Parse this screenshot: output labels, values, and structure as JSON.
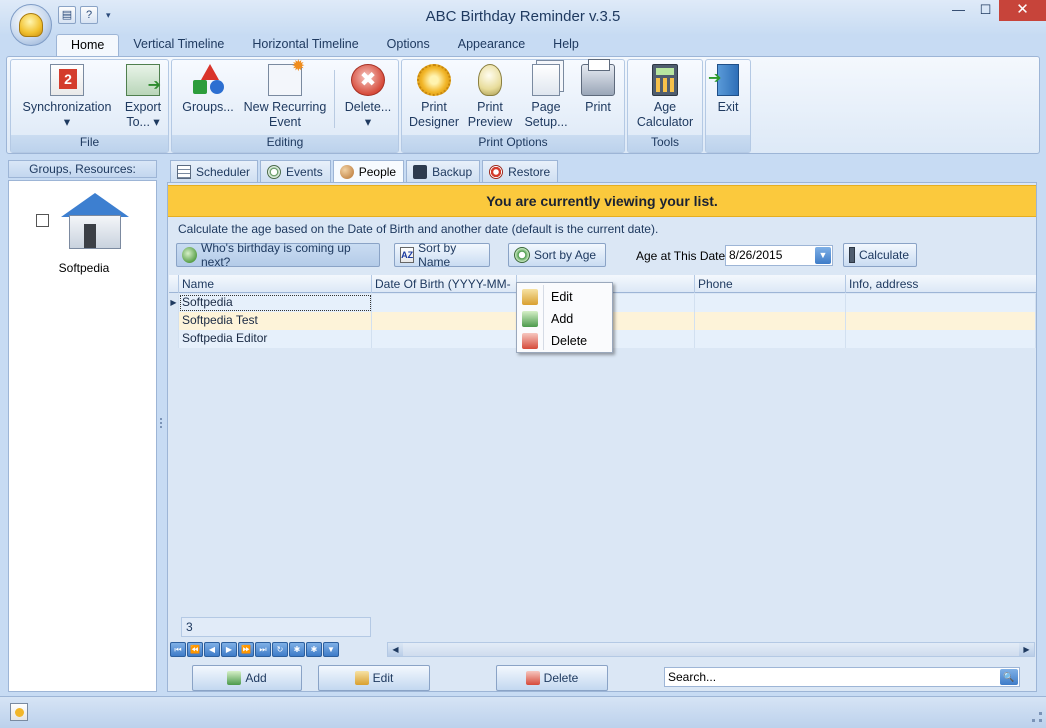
{
  "window": {
    "title": "ABC Birthday Reminder v.3.5",
    "minimize": "—",
    "maximize": "☐",
    "close": "✕"
  },
  "qat": {
    "print_icon": "printer-icon",
    "help_label": "?",
    "dropdown": "▾"
  },
  "ribbon_tabs": [
    "Home",
    "Vertical Timeline",
    "Horizontal Timeline",
    "Options",
    "Appearance",
    "Help"
  ],
  "ribbon": {
    "file": {
      "label": "File",
      "sync": "Synchronization",
      "sync_arrow": "▾",
      "export": "Export",
      "export_to": "To... ▾"
    },
    "editing": {
      "label": "Editing",
      "groups": "Groups...",
      "new_recurring_1": "New Recurring",
      "new_recurring_2": "Event",
      "delete": "Delete...",
      "delete_arrow": "▾",
      "delete_icon_glyph": "✖"
    },
    "print": {
      "label": "Print Options",
      "designer_1": "Print",
      "designer_2": "Designer",
      "preview_1": "Print",
      "preview_2": "Preview",
      "setup_1": "Page",
      "setup_2": "Setup...",
      "print": "Print"
    },
    "tools": {
      "label": "Tools",
      "age_1": "Age",
      "age_2": "Calculator"
    },
    "exit": "Exit"
  },
  "left_panel": {
    "header": "Groups, Resources:",
    "group_name": "Softpedia"
  },
  "content_tabs": [
    "Scheduler",
    "Events",
    "People",
    "Backup",
    "Restore"
  ],
  "main": {
    "banner": "You are currently viewing your list.",
    "description": "Calculate the age based on the Date of Birth and another date (default is the current date).",
    "whos_birthday": "Who's birthday is coming up next?",
    "sort_name": "Sort by Name",
    "sort_age": "Sort by Age",
    "age_at_label": "Age at This Date:",
    "age_date": "8/26/2015",
    "calculate": "Calculate",
    "date_drop": "▼",
    "az_icon": "AZ"
  },
  "grid": {
    "columns": [
      "Name",
      "Date Of Birth (YYYY-MM-DD)",
      "",
      "Phone",
      "Info, address"
    ],
    "rows": [
      {
        "name": "Softpedia",
        "indicator": "▶"
      },
      {
        "name": "Softpedia Test",
        "indicator": ""
      },
      {
        "name": "Softpedia Editor",
        "indicator": ""
      }
    ],
    "count": "3"
  },
  "navigator": [
    "⏮",
    "⏪",
    "◀",
    "▶",
    "⏩",
    "⏭",
    "↻",
    "✱",
    "✱",
    "▼"
  ],
  "scroll": {
    "left": "◀",
    "right": "▶"
  },
  "actions": {
    "add": "Add",
    "edit": "Edit",
    "delete": "Delete",
    "search_placeholder": "Search...",
    "search_icon": "🔍"
  },
  "context_menu": {
    "edit": "Edit",
    "add": "Add",
    "delete": "Delete"
  }
}
